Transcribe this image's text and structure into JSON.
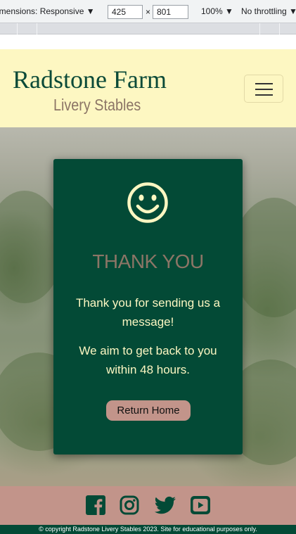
{
  "devtools": {
    "dimensions_label": "imensions: Responsive ▼",
    "width_value": "425",
    "times": "×",
    "height_value": "801",
    "zoom": "100% ▼",
    "throttling": "No throttling ▼"
  },
  "header": {
    "title": "Radstone Farm",
    "subtitle": "Livery Stables"
  },
  "card": {
    "icon": "smiley-face-icon",
    "heading": "THANK YOU",
    "message_1": "Thank you for sending us a message!",
    "message_2": "We aim to get back to you within 48 hours.",
    "button_label": "Return Home"
  },
  "footer": {
    "social_icons": [
      "facebook-icon",
      "instagram-icon",
      "twitter-icon",
      "youtube-icon"
    ],
    "copyright": "© copyright Radstone Livery Stables 2023. Site for educational purposes only."
  },
  "colors": {
    "primary_green": "#034a36",
    "cream": "#fdf7c2",
    "taupe": "#8c7566",
    "rose": "#c2948a"
  }
}
